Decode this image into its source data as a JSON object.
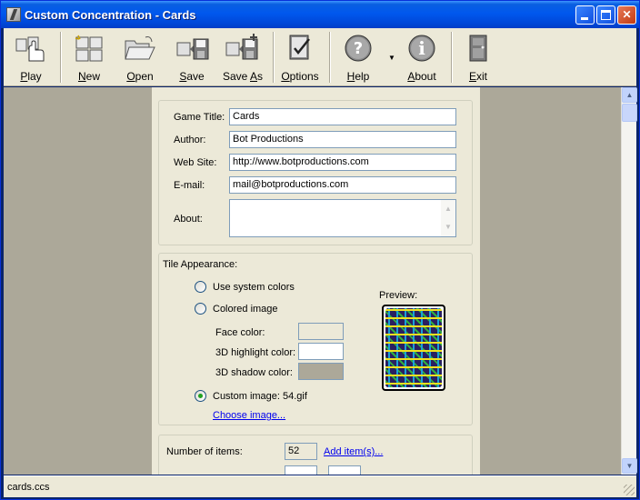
{
  "window": {
    "title": "Custom Concentration - Cards"
  },
  "toolbar": [
    {
      "label": "Play",
      "accel": "P",
      "rest": "lay",
      "icon": "play-hand-icon"
    },
    {
      "label": "New",
      "accel": "N",
      "rest": "ew",
      "icon": "new-tiles-icon"
    },
    {
      "label": "Open",
      "accel": "O",
      "rest": "pen",
      "icon": "open-folder-icon"
    },
    {
      "label": "Save",
      "accel": "S",
      "rest": "ave",
      "icon": "save-disk-icon"
    },
    {
      "label": "Save As",
      "pre": "Save ",
      "accel": "A",
      "rest": "s",
      "icon": "save-as-icon"
    },
    {
      "label": "Options",
      "pre": "",
      "accel": "O",
      "rest": "ptions",
      "icon": "options-checklist-icon"
    },
    {
      "label": "Help",
      "accel": "H",
      "rest": "elp",
      "icon": "help-icon"
    },
    {
      "label": "About",
      "pre": "",
      "accel": "A",
      "rest": "bout",
      "icon": "about-info-icon"
    },
    {
      "label": "Exit",
      "accel": "E",
      "rest": "xit",
      "icon": "exit-door-icon"
    }
  ],
  "form": {
    "game_title_label": "Game Title:",
    "game_title_value": "Cards",
    "author_label": "Author:",
    "author_value": "Bot Productions",
    "website_label": "Web Site:",
    "website_value": "http://www.botproductions.com",
    "email_label": "E-mail:",
    "email_value": "mail@botproductions.com",
    "about_label": "About:",
    "about_value": ""
  },
  "tile": {
    "group_label": "Tile Appearance:",
    "use_system_colors": "Use system colors",
    "colored_image": "Colored image",
    "face_color_label": "Face color:",
    "highlight_color_label": "3D highlight color:",
    "shadow_color_label": "3D shadow color:",
    "custom_image_label": "Custom image:",
    "custom_image_value": "54.gif",
    "choose_image_link": "Choose image...",
    "preview_label": "Preview:",
    "selected_option": "custom_image",
    "face_color": "#ece9d8",
    "highlight_color": "#ffffff",
    "shadow_color": "#aca899"
  },
  "items": {
    "count_label": "Number of items:",
    "count_value": "52",
    "add_items_link": "Add item(s)..."
  },
  "status": {
    "text": "cards.ccs"
  }
}
